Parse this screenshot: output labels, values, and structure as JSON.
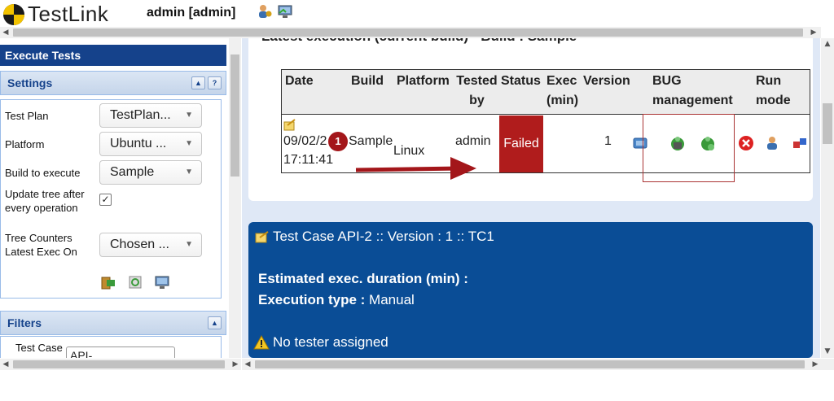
{
  "header": {
    "logo_text": "TestLink",
    "user": "admin [admin]"
  },
  "left": {
    "exec_title": "Execute Tests",
    "settings": {
      "title": "Settings",
      "test_plan_label": "Test Plan",
      "test_plan_value": "TestPlan...",
      "platform_label": "Platform",
      "platform_value": "Ubuntu ...",
      "build_label": "Build to execute",
      "build_value": "Sample",
      "update_tree_label": "Update tree after every operation",
      "update_tree_checked": true,
      "tree_counters_label": "Tree Counters Latest Exec On",
      "tree_counters_value": "Chosen ..."
    },
    "filters": {
      "title": "Filters",
      "test_case_label": "Test Case",
      "test_case_value": "API-"
    }
  },
  "main": {
    "latest_exec_heading": "Latest execution (current build) - Build : Sample",
    "table": {
      "headers": [
        "Date",
        "Build",
        "Platform",
        "Tested by",
        "Status",
        "Exec (min)",
        "Version",
        "BUG management",
        "Run mode"
      ],
      "row": {
        "date": "09/02/2",
        "time": "17:11:41",
        "build": "Sample",
        "platform": "Linux",
        "tested_by": "admin",
        "status": "Failed",
        "version": "1"
      }
    },
    "annotation_badge": "1",
    "test_case": {
      "title": "Test Case API-2 :: Version : 1 :: TC1",
      "est_label": "Estimated exec. duration (min) :",
      "exec_type_label": "Execution type :",
      "exec_type_value": "Manual",
      "no_tester": "No tester assigned"
    }
  },
  "colors": {
    "accent": "#15428b",
    "failed": "#b01c1c",
    "tc_panel": "#0a4d96"
  }
}
